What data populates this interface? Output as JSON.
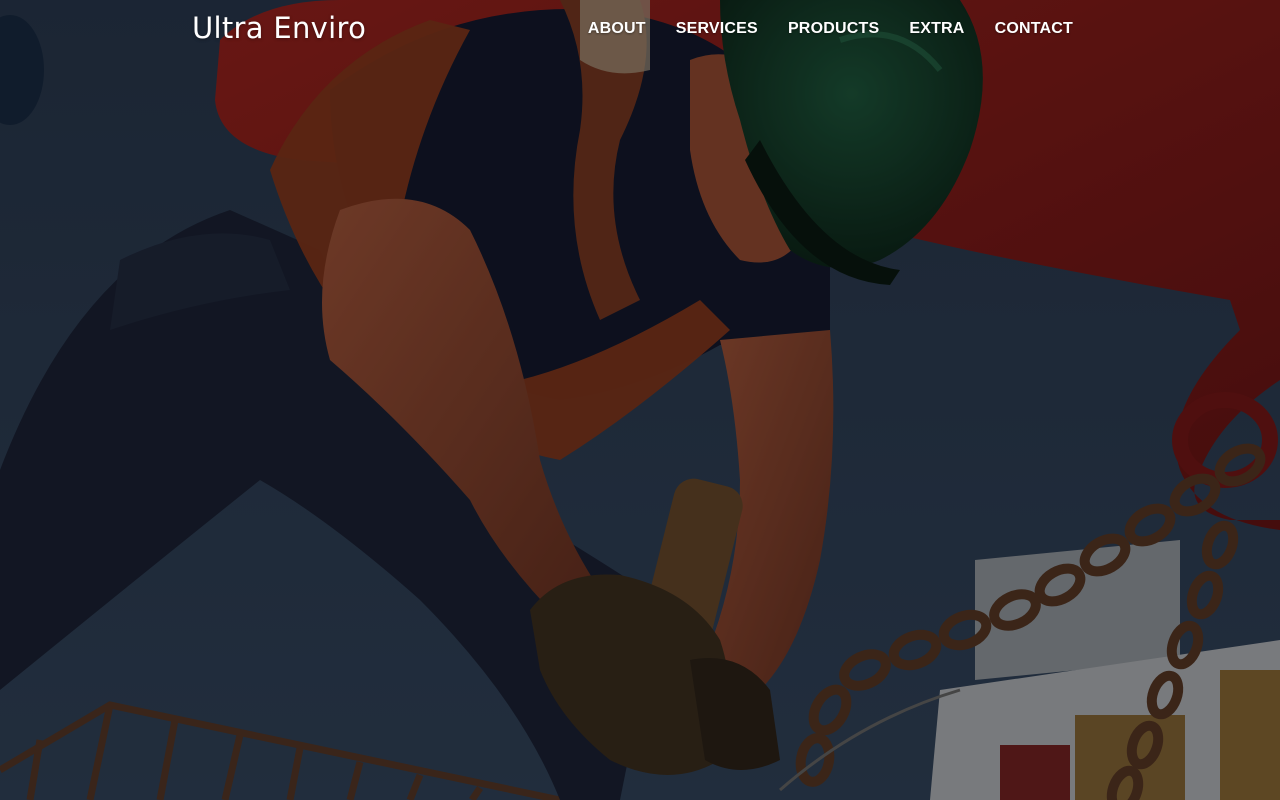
{
  "site": {
    "logo_text": "Ultra Enviro"
  },
  "nav": {
    "items": [
      {
        "label": "ABOUT"
      },
      {
        "label": "SERVICES"
      },
      {
        "label": "PRODUCTS"
      },
      {
        "label": "EXTRA"
      },
      {
        "label": "CONTACT"
      }
    ]
  },
  "colors": {
    "sky": "#24344a",
    "buoy_red": "#8c1c1c",
    "hardhat_green": "#153a2a",
    "overlay": "rgba(0,0,0,0.35)",
    "nav_text": "#ffffff"
  }
}
